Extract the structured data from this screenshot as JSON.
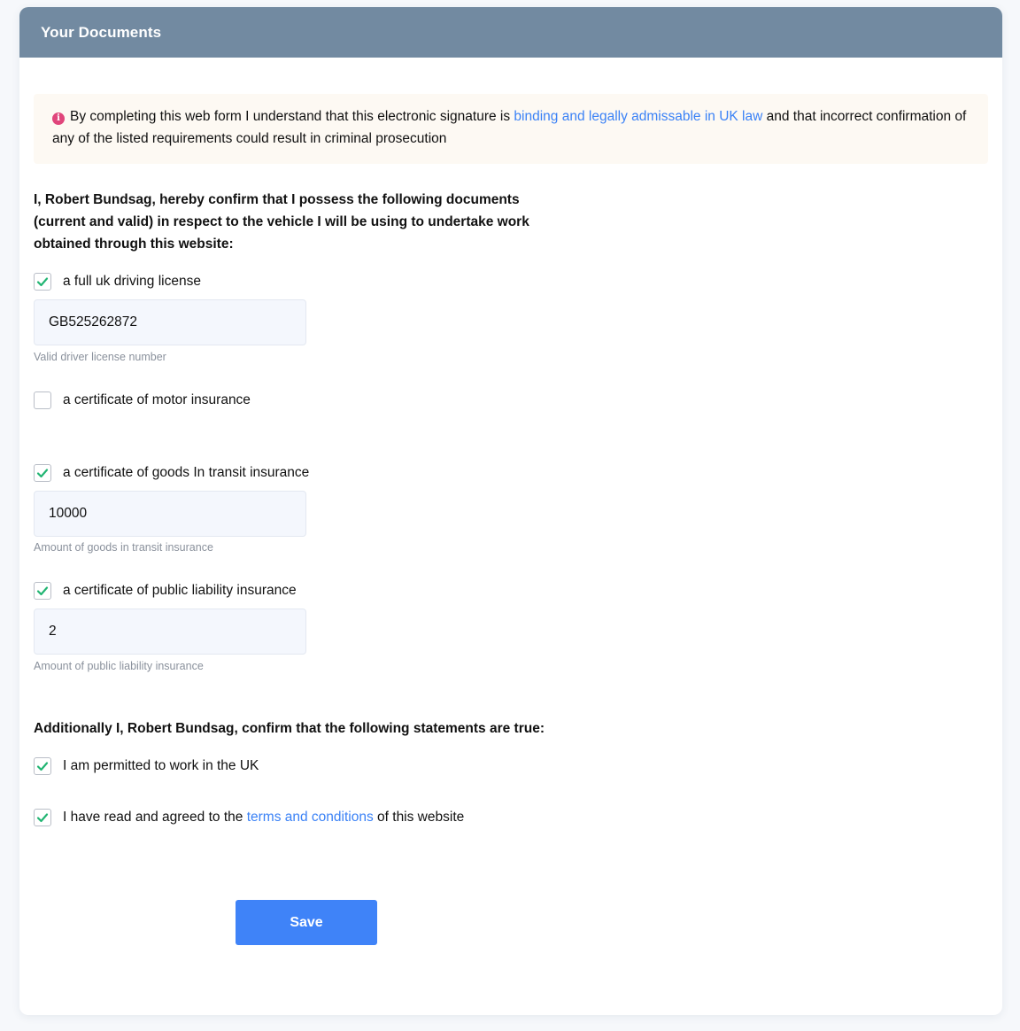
{
  "header": {
    "title": "Your Documents"
  },
  "notice": {
    "icon": "info-icon",
    "text_before": "By completing this web form I understand that this electronic signature is ",
    "link_text": "binding and legally admissable in UK law",
    "text_after": " and that incorrect confirmation of any of the listed requirements could result in criminal prosecution"
  },
  "intro": "I, Robert Bundsag, hereby confirm that I possess the following documents (current and valid) in respect to the vehicle I will be using to undertake work obtained through this website:",
  "documents": [
    {
      "label": "a full uk driving license",
      "checked": true,
      "value": "GB525262872",
      "hint": "Valid driver license number"
    },
    {
      "label": "a certificate of motor insurance",
      "checked": false
    },
    {
      "label": "a certificate of goods In transit insurance",
      "checked": true,
      "value": "10000",
      "hint": "Amount of goods in transit insurance"
    },
    {
      "label": "a certificate of public liability insurance",
      "checked": true,
      "value": "2",
      "hint": "Amount of public liability insurance"
    }
  ],
  "statements": {
    "heading": "Additionally I, Robert Bundsag, confirm that the following statements are true:",
    "items": [
      {
        "label": "I am permitted to work in the UK",
        "checked": true
      },
      {
        "label_before": "I have read and agreed to the ",
        "link_text": "terms and conditions",
        "label_after": " of this website",
        "checked": true
      }
    ]
  },
  "save_label": "Save",
  "colors": {
    "header": "#728aa1",
    "accent": "#3f83f8",
    "check": "#22b573",
    "notice_bg": "#fdf9f3"
  }
}
